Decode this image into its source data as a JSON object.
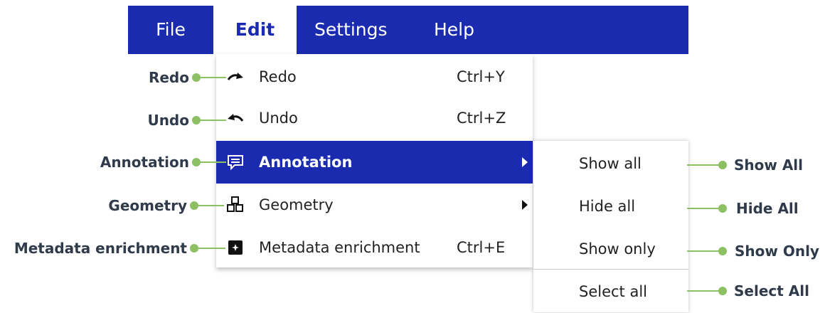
{
  "menubar": {
    "items": [
      {
        "label": "File"
      },
      {
        "label": "Edit"
      },
      {
        "label": "Settings"
      },
      {
        "label": "Help"
      }
    ]
  },
  "edit_menu": {
    "items": [
      {
        "label": "Redo",
        "shortcut": "Ctrl+Y",
        "icon": "redo-icon"
      },
      {
        "label": "Undo",
        "shortcut": "Ctrl+Z",
        "icon": "undo-icon"
      },
      {
        "label": "Annotation",
        "icon": "annotation-icon"
      },
      {
        "label": "Geometry",
        "icon": "geometry-icon"
      },
      {
        "label": "Metadata enrichment",
        "shortcut": "Ctrl+E",
        "icon": "metadata-icon"
      }
    ]
  },
  "annotation_submenu": {
    "items": [
      {
        "label": "Show all"
      },
      {
        "label": "Hide all"
      },
      {
        "label": "Show only"
      },
      {
        "label": "Select all"
      }
    ]
  },
  "callouts_left": [
    "Redo",
    "Undo",
    "Annotation",
    "Geometry",
    "Metadata enrichment"
  ],
  "callouts_right": [
    "Show All",
    "Hide All",
    "Show Only",
    "Select All"
  ],
  "colors": {
    "menubar": "#1a2bb0",
    "highlight": "#1a2bb0",
    "callout": "#8cc063",
    "callout_text": "#2f3b4a"
  }
}
